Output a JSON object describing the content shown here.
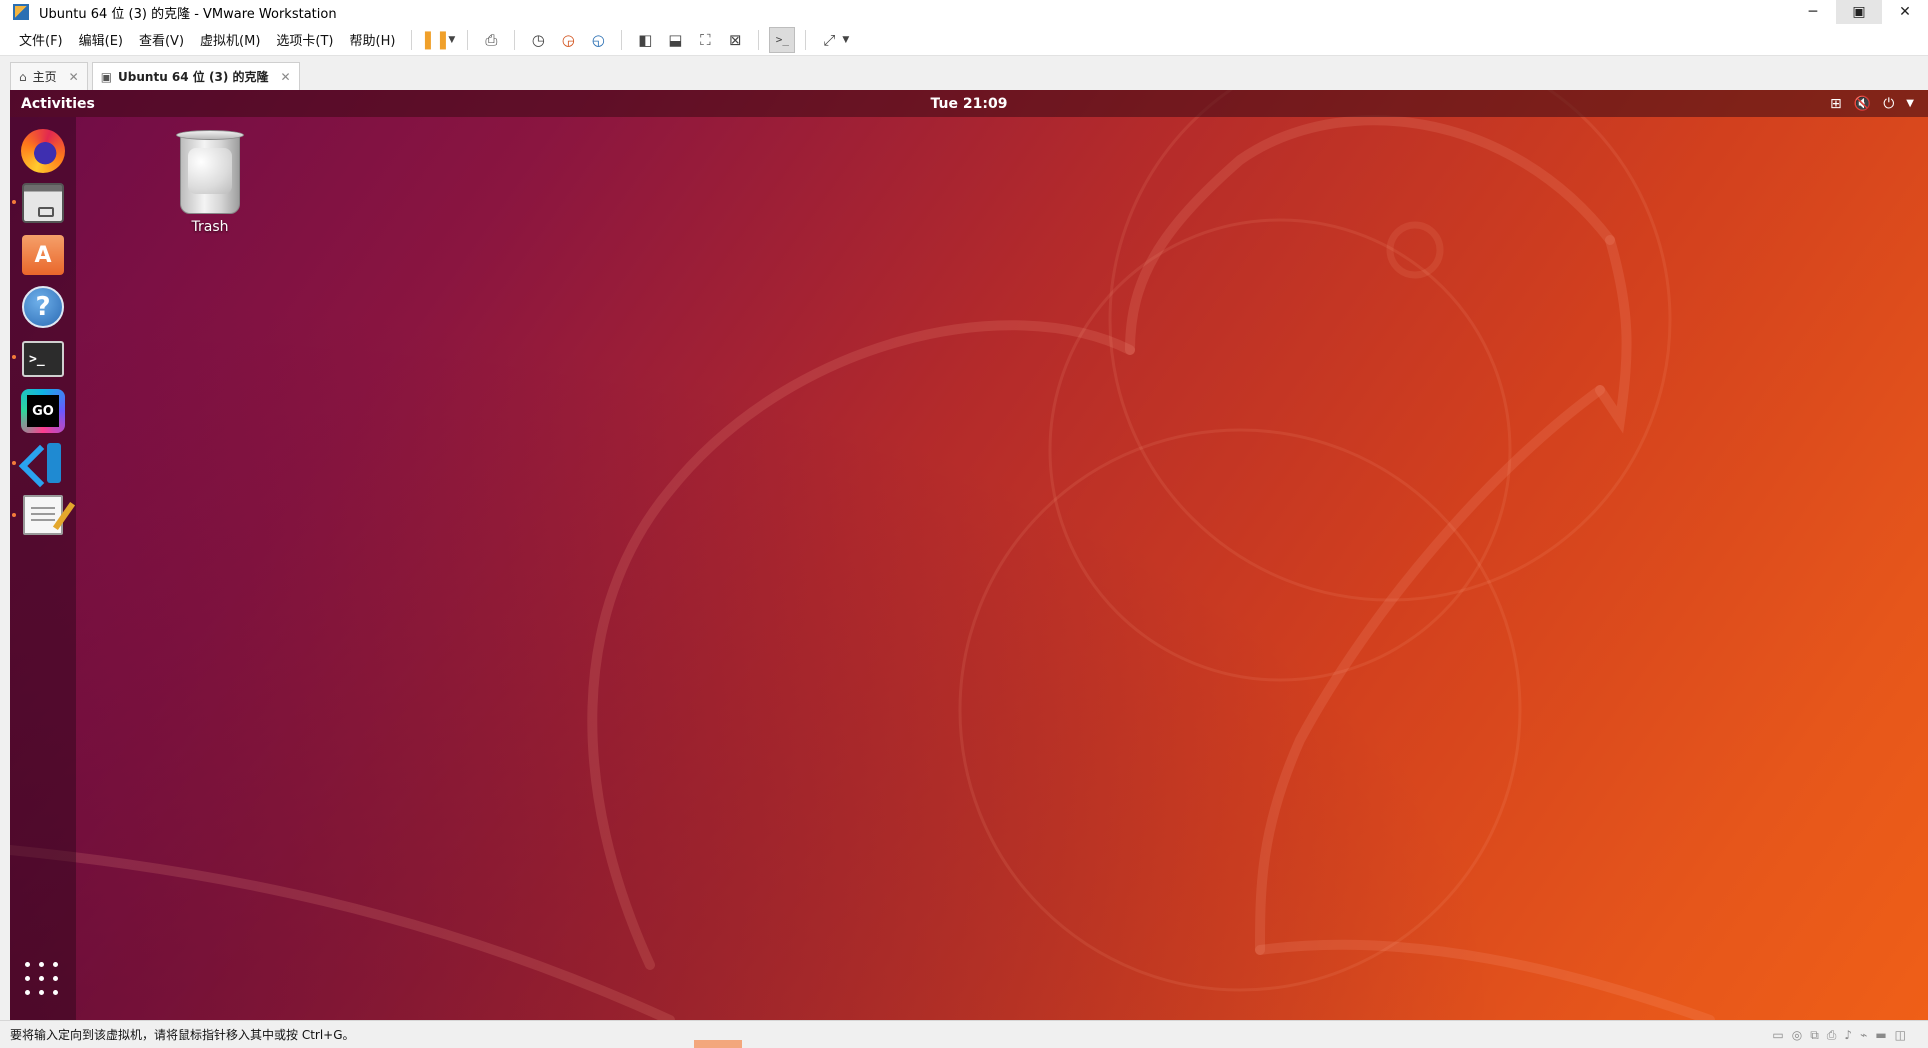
{
  "window": {
    "title": "Ubuntu 64 位 (3) 的克隆 - VMware Workstation",
    "controls": {
      "minimize": "─",
      "maximize": "▣",
      "close": "✕"
    }
  },
  "menu": [
    "文件(F)",
    "编辑(E)",
    "查看(V)",
    "虚拟机(M)",
    "选项卡(T)",
    "帮助(H)"
  ],
  "toolbar_icons": [
    "pause-icon",
    "send-ctrl-alt-del-icon",
    "snapshot-icon",
    "revert-snapshot-icon",
    "snapshot-manager-icon",
    "library-icon",
    "thumbnail-bar-icon",
    "full-screen-icon",
    "unity-icon",
    "console-view-icon",
    "stretch-guest-icon"
  ],
  "tabs": [
    {
      "label": "主页",
      "icon": "home-icon"
    },
    {
      "label": "Ubuntu 64 位 (3) 的克隆",
      "icon": "vm-icon"
    }
  ],
  "guest": {
    "activities": "Activities",
    "clock": "Tue 21:09",
    "tray_icons": [
      "network-icon",
      "volume-muted-icon",
      "power-icon",
      "menu-caret-icon"
    ],
    "dock": [
      {
        "name": "firefox",
        "running": false
      },
      {
        "name": "files",
        "running": true
      },
      {
        "name": "software-center",
        "running": false,
        "glyph": "A"
      },
      {
        "name": "help",
        "running": false,
        "glyph": "?"
      },
      {
        "name": "terminal",
        "running": true,
        "glyph": ">_"
      },
      {
        "name": "goland",
        "running": false,
        "glyph": "GO"
      },
      {
        "name": "vscode",
        "running": true
      },
      {
        "name": "text-editor",
        "running": true
      }
    ],
    "desktop": {
      "trash_label": "Trash"
    },
    "colors": {
      "wallpaper_start": "#6e0b47",
      "wallpaper_end": "#ef5f17",
      "run_indicator": "#f47b3a"
    }
  },
  "status": {
    "message": "要将输入定向到该虚拟机，请将鼠标指针移入其中或按 Ctrl+G。",
    "icons": [
      "hard-disk-icon",
      "cd-icon",
      "network-adapter-icon",
      "printer-icon",
      "sound-icon",
      "usb-icon",
      "display-icon",
      "message-icon"
    ]
  }
}
